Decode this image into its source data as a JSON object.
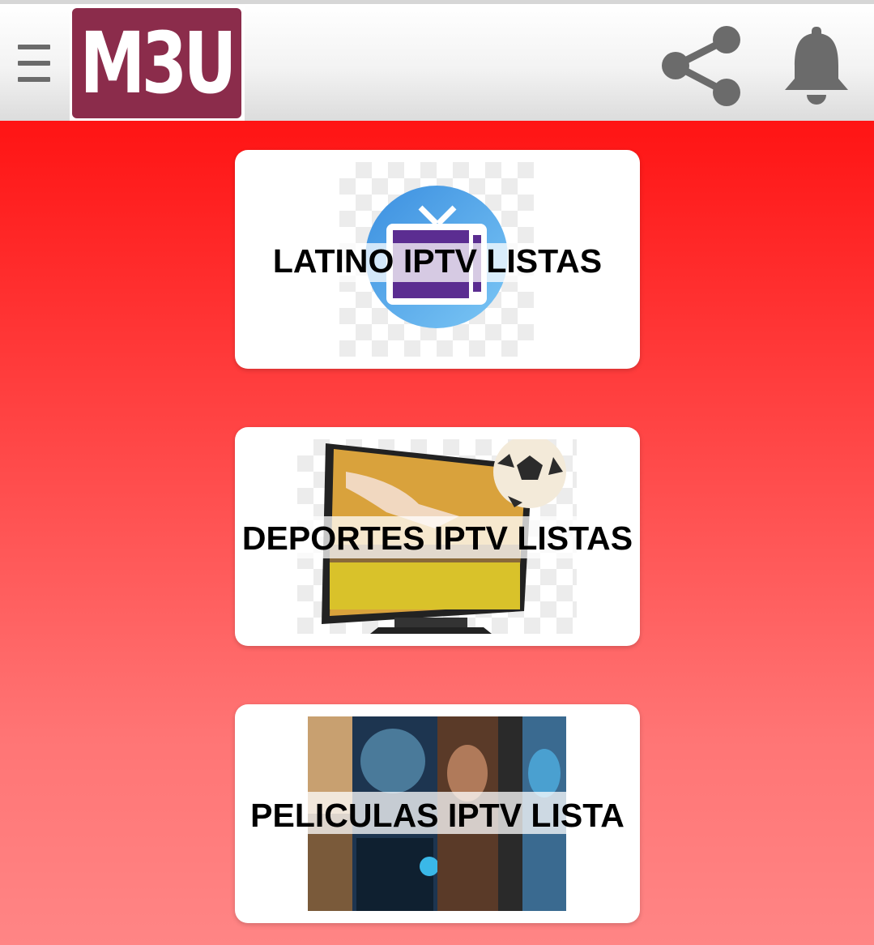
{
  "header": {
    "logo_text": "M3U",
    "menu_icon": "hamburger-menu-icon",
    "share_icon": "share-icon",
    "notification_icon": "bell-icon"
  },
  "colors": {
    "logo_bg": "#8b2c4b",
    "gradient_top": "#ff1414",
    "gradient_bottom": "#ff8585",
    "card_bg": "#ffffff",
    "icon_gray": "#6b6b6b"
  },
  "cards": [
    {
      "label": "LATINO IPTV LISTAS",
      "image": "tv-icon-thumbnail"
    },
    {
      "label": "DEPORTES IPTV LISTAS",
      "image": "tv-soccer-thumbnail"
    },
    {
      "label": "PELICULAS IPTV LISTA",
      "image": "movie-posters-thumbnail"
    }
  ]
}
